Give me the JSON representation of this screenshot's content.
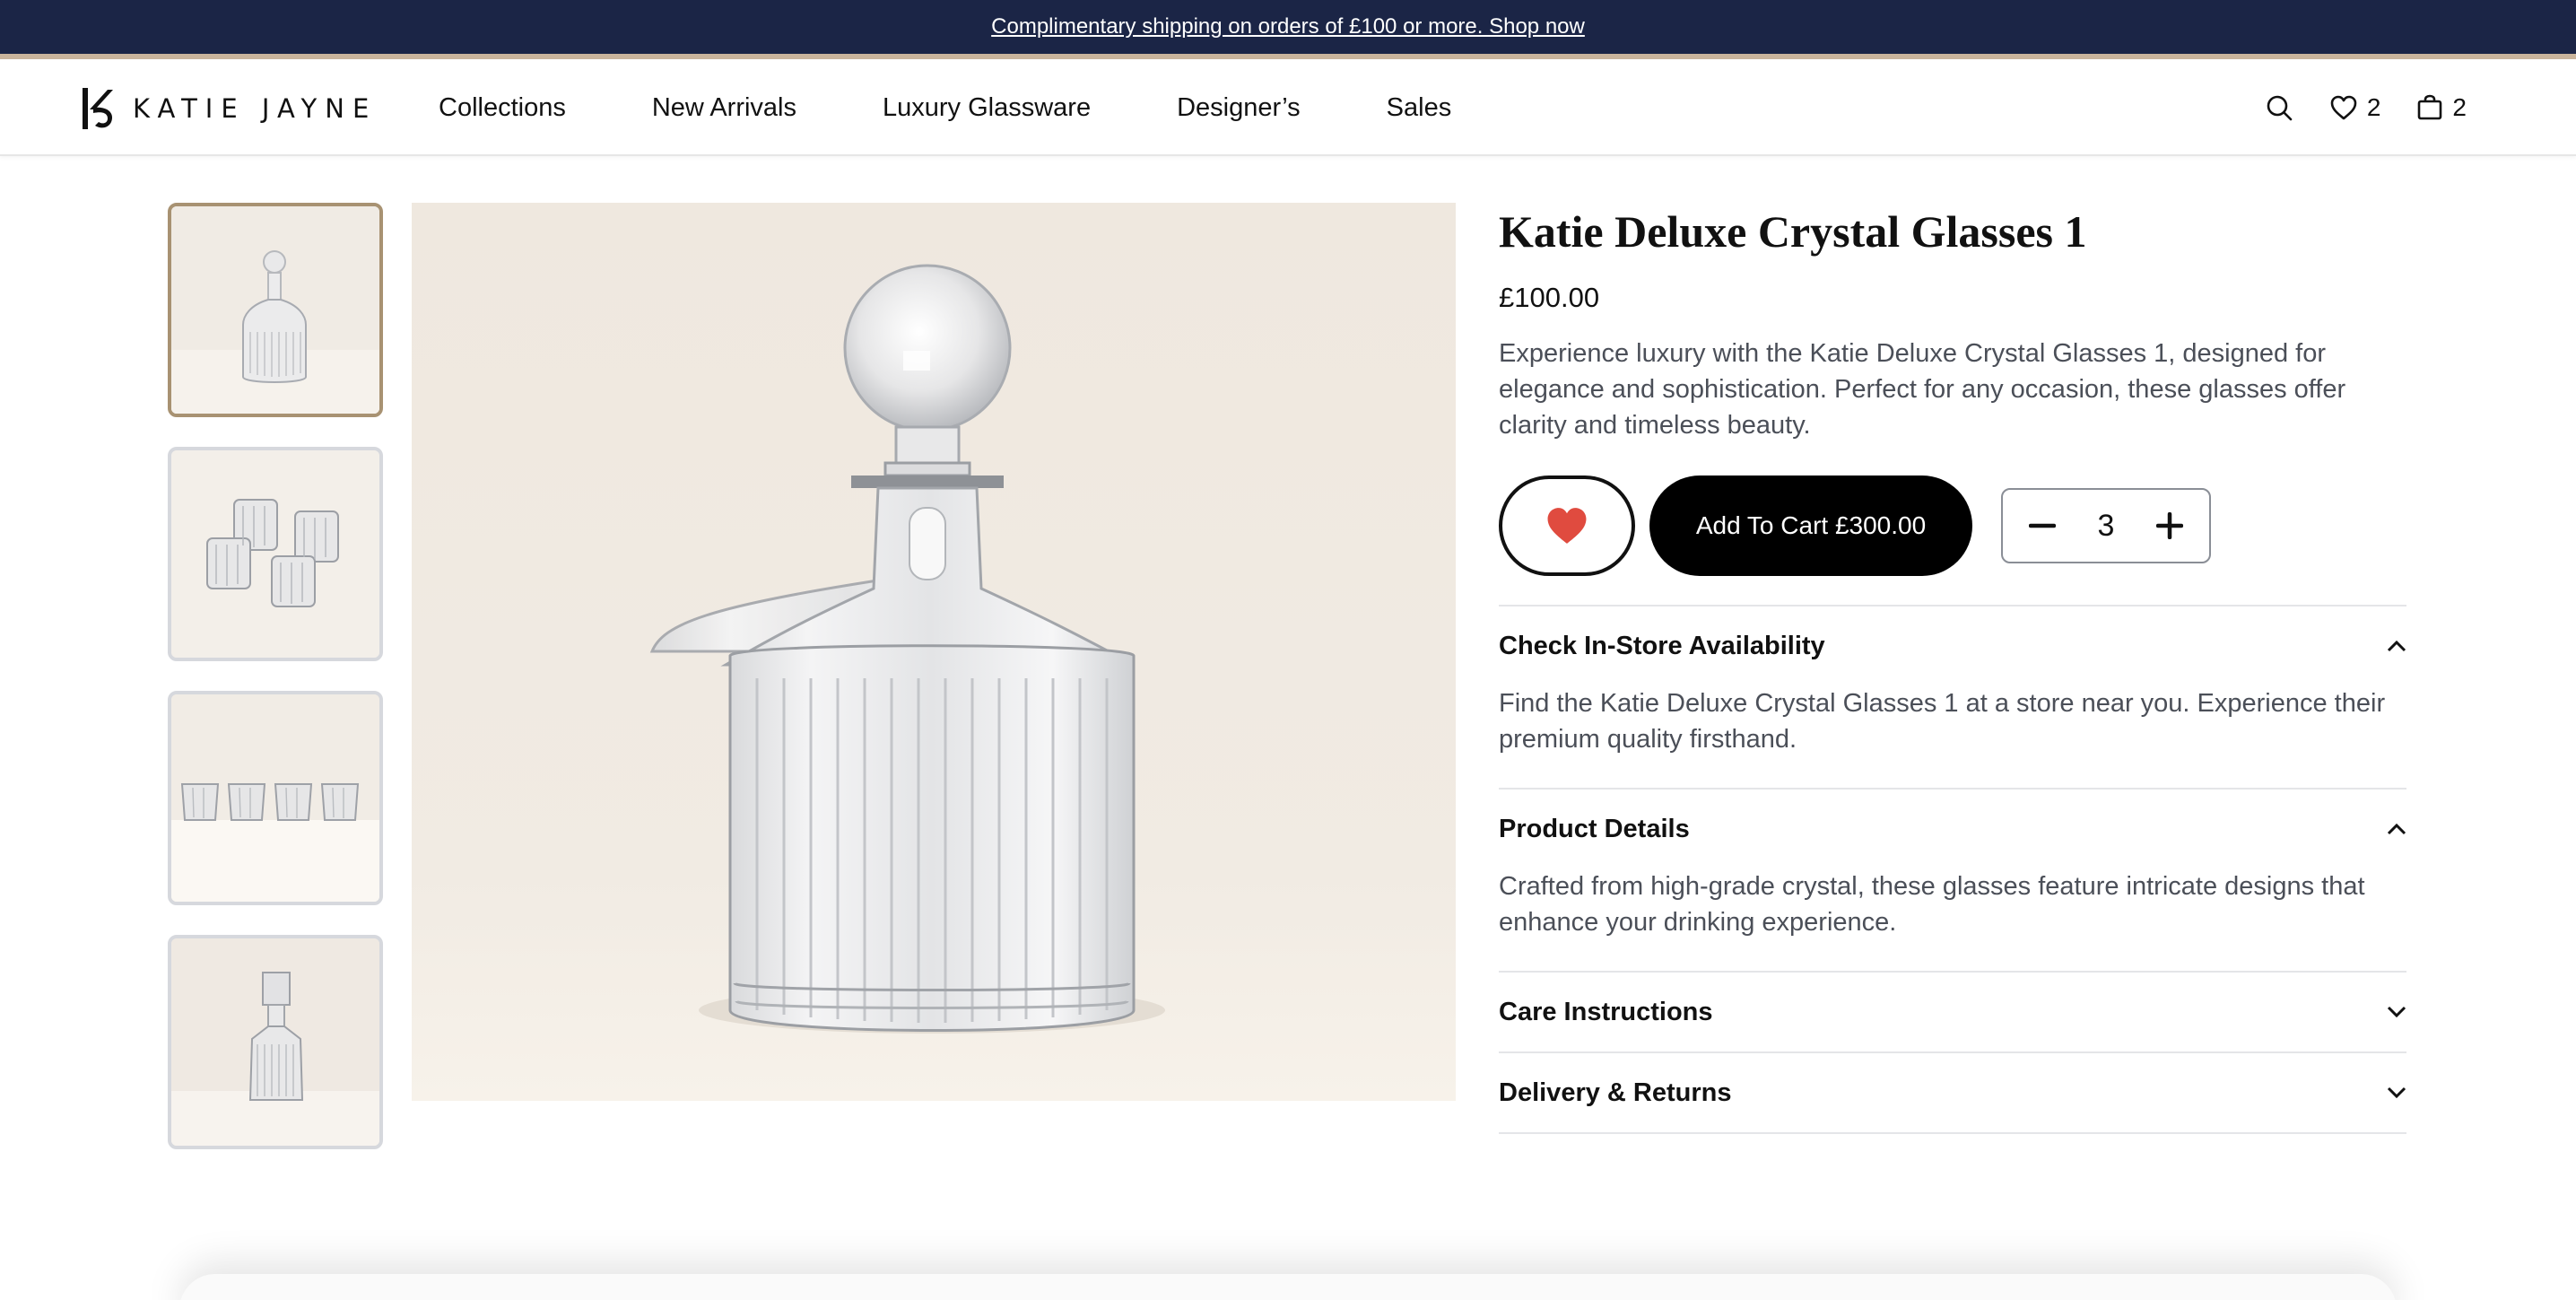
{
  "announcement": {
    "text": "Complimentary shipping on orders of £100 or more. Shop now"
  },
  "header": {
    "logo_text": "KATIE JAYNE",
    "nav": [
      {
        "label": "Collections"
      },
      {
        "label": "New Arrivals"
      },
      {
        "label": "Luxury Glassware"
      },
      {
        "label": "Designer’s"
      },
      {
        "label": "Sales"
      }
    ],
    "icons": {
      "search": "search-icon",
      "wishlist": "heart-icon",
      "cart": "bag-icon"
    },
    "wishlist_count": "2",
    "cart_count": "2"
  },
  "gallery": {
    "thumbnails": [
      {
        "name": "decanter-front",
        "active": true
      },
      {
        "name": "four-tumblers-top",
        "active": false
      },
      {
        "name": "four-tumblers-row",
        "active": false
      },
      {
        "name": "square-decanter",
        "active": false
      }
    ]
  },
  "product": {
    "title": "Katie Deluxe Crystal Glasses 1",
    "price": "£100.00",
    "description": "Experience luxury with the Katie Deluxe Crystal Glasses 1, designed for elegance and sophistication. Perfect for any occasion, these glasses offer clarity and timeless beauty.",
    "add_to_cart_label": "Add To Cart £300.00",
    "quantity": "3",
    "wishlisted": true,
    "heart_color": "#e04b3f"
  },
  "accordion": [
    {
      "title": "Check In-Store Availability",
      "expanded": true,
      "body": "Find the Katie Deluxe Crystal Glasses 1 at a store near you. Experience their premium quality firsthand."
    },
    {
      "title": "Product Details",
      "expanded": true,
      "body": "Crafted from high-grade crystal, these glasses feature intricate designs that enhance your drinking experience."
    },
    {
      "title": "Care Instructions",
      "expanded": false,
      "body": ""
    },
    {
      "title": "Delivery & Returns",
      "expanded": false,
      "body": ""
    }
  ],
  "colors": {
    "announcement_bg": "#1b2546",
    "accent_stripe": "#c9b49c",
    "active_thumb_border": "#a89272",
    "button_bg": "#000000"
  }
}
